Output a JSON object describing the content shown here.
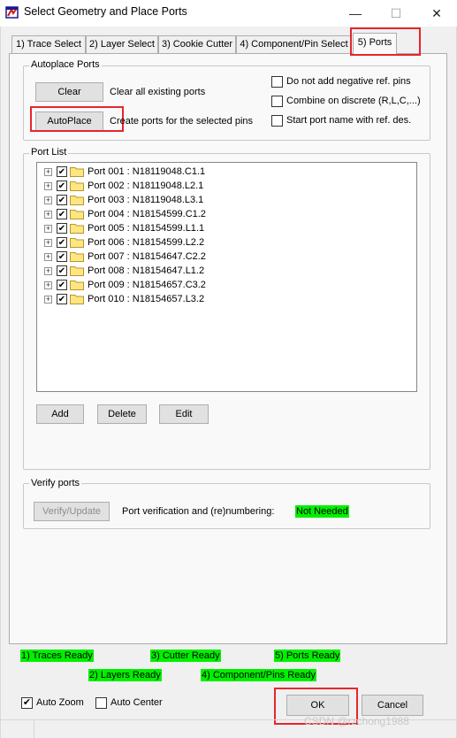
{
  "window": {
    "title": "Select Geometry and Place Ports",
    "minimize": "—",
    "maximize": "☐",
    "close": "✕"
  },
  "tabs": [
    {
      "label": "1) Trace Select"
    },
    {
      "label": "2) Layer Select"
    },
    {
      "label": "3) Cookie Cutter"
    },
    {
      "label": "4) Component/Pin Select"
    },
    {
      "label": "5) Ports",
      "active": true
    }
  ],
  "autoplace": {
    "legend": "Autoplace Ports",
    "clear_label": "Clear",
    "clear_desc": "Clear all existing ports",
    "autoplace_label": "AutoPlace",
    "autoplace_desc": "Create ports for the selected pins",
    "options": [
      {
        "label": "Do not add negative ref. pins",
        "checked": false
      },
      {
        "label": "Combine on discrete (R,L,C,...)",
        "checked": false
      },
      {
        "label": "Start port name with ref. des.",
        "checked": false
      }
    ]
  },
  "port_list": {
    "legend": "Port List",
    "items": [
      {
        "label": "Port 001 : N18119048.C1.1",
        "checked": true
      },
      {
        "label": "Port 002 : N18119048.L2.1",
        "checked": true
      },
      {
        "label": "Port 003 : N18119048.L3.1",
        "checked": true
      },
      {
        "label": "Port 004 : N18154599.C1.2",
        "checked": true
      },
      {
        "label": "Port 005 : N18154599.L1.1",
        "checked": true
      },
      {
        "label": "Port 006 : N18154599.L2.2",
        "checked": true
      },
      {
        "label": "Port 007 : N18154647.C2.2",
        "checked": true
      },
      {
        "label": "Port 008 : N18154647.L1.2",
        "checked": true
      },
      {
        "label": "Port 009 : N18154657.C3.2",
        "checked": true
      },
      {
        "label": "Port 010 : N18154657.L3.2",
        "checked": true
      }
    ],
    "add_label": "Add",
    "delete_label": "Delete",
    "edit_label": "Edit"
  },
  "verify": {
    "legend": "Verify ports",
    "button_label": "Verify/Update",
    "desc": "Port verification and (re)numbering:",
    "status": "Not Needed"
  },
  "statuses": {
    "traces": "1) Traces Ready",
    "cutter": "3) Cutter Ready",
    "ports": "5) Ports Ready",
    "layers": "2) Layers Ready",
    "components": "4) Component/Pins Ready"
  },
  "footer": {
    "auto_zoom_label": "Auto Zoom",
    "auto_zoom_checked": true,
    "auto_center_label": "Auto Center",
    "auto_center_checked": false,
    "ok_label": "OK",
    "cancel_label": "Cancel"
  },
  "watermark": "CSDN @rzchong1988",
  "colors": {
    "status_green": "#00f000",
    "highlight_red": "#e6262b",
    "folder_yellow": "#ffe680"
  }
}
